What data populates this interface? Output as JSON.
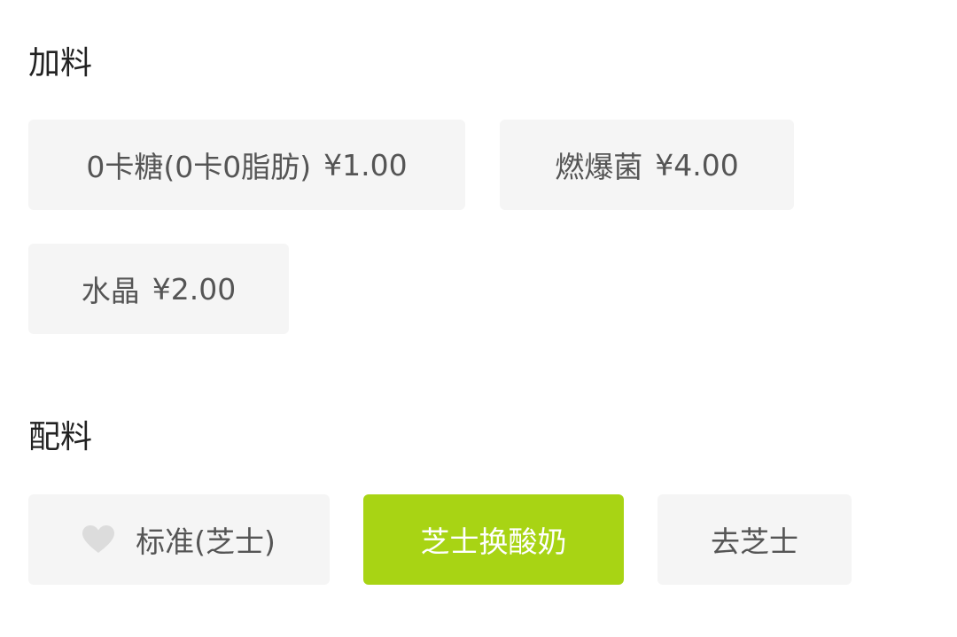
{
  "addons": {
    "title": "加料",
    "options": [
      {
        "name": "0卡糖(0卡0脂肪)",
        "price": "¥1.00"
      },
      {
        "name": "燃爆菌",
        "price": "¥4.00"
      },
      {
        "name": "水晶",
        "price": "¥2.00"
      }
    ]
  },
  "ingredients": {
    "title": "配料",
    "options": [
      {
        "name": "标准(芝士)",
        "icon": "heart-icon",
        "selected": false
      },
      {
        "name": "芝士换酸奶",
        "selected": true
      },
      {
        "name": "去芝士",
        "selected": false
      }
    ]
  },
  "colors": {
    "chip_bg": "#f5f5f5",
    "selected_bg": "#a8d414",
    "chip_text": "#555555",
    "selected_text": "#ffffff",
    "heart": "#dcdcdc"
  }
}
